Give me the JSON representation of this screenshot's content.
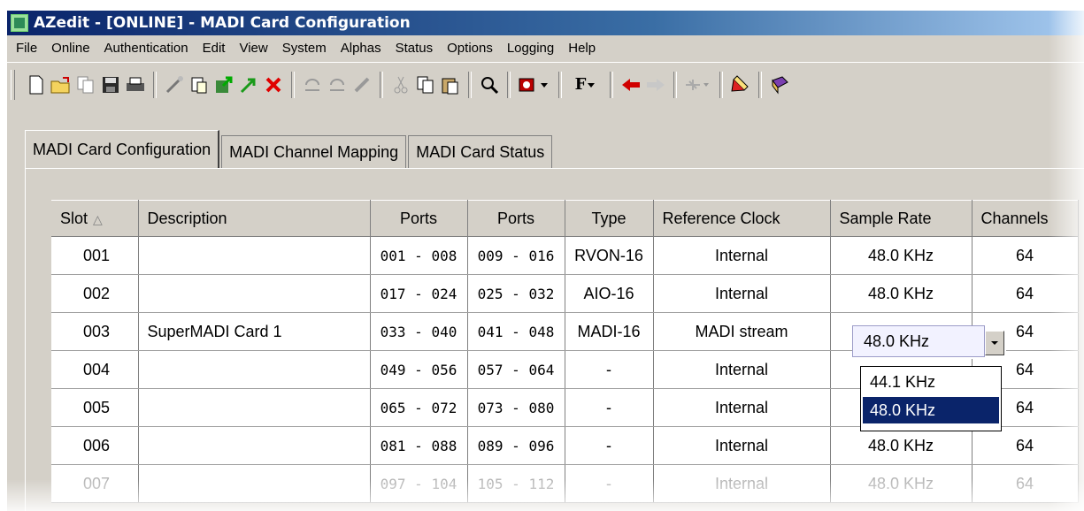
{
  "window": {
    "title": "AZedit - [ONLINE] - MADI Card Configuration"
  },
  "menu": [
    "File",
    "Online",
    "Authentication",
    "Edit",
    "View",
    "System",
    "Alphas",
    "Status",
    "Options",
    "Logging",
    "Help"
  ],
  "toolbar": {
    "icons": [
      "new-icon",
      "open-icon",
      "copy-doc-icon",
      "save-icon",
      "print-icon",
      "wand-icon",
      "paste-doc-icon",
      "upload-icon",
      "arrow-up-green-icon",
      "cancel-icon",
      "undo-icon",
      "redo-icon",
      "pen-icon",
      "cut-icon",
      "copy-icon",
      "paste-icon",
      "search-icon",
      "keypanel-icon",
      "font-icon",
      "back-icon",
      "forward-icon",
      "network-icon",
      "marker-icon",
      "book-icon"
    ],
    "font_label": "F"
  },
  "tabs": [
    "MADI Card Configuration",
    "MADI Channel Mapping",
    "MADI Card Status"
  ],
  "grid": {
    "columns": [
      "Slot",
      "Description",
      "Ports",
      "Ports",
      "Type",
      "Reference Clock",
      "Sample Rate",
      "Channels"
    ],
    "sort_indicator": "△",
    "rows": [
      {
        "slot": "001",
        "desc": "",
        "ports_a": "001 - 008",
        "ports_b": "009 - 016",
        "type": "RVON-16",
        "clock": "Internal",
        "rate": "48.0 KHz",
        "channels": "64"
      },
      {
        "slot": "002",
        "desc": "",
        "ports_a": "017 - 024",
        "ports_b": "025 - 032",
        "type": "AIO-16",
        "clock": "Internal",
        "rate": "48.0 KHz",
        "channels": "64"
      },
      {
        "slot": "003",
        "desc": "SuperMADI Card 1",
        "ports_a": "033 - 040",
        "ports_b": "041 - 048",
        "type": "MADI-16",
        "clock": "MADI stream",
        "rate": "",
        "channels": "64"
      },
      {
        "slot": "004",
        "desc": "",
        "ports_a": "049 - 056",
        "ports_b": "057 - 064",
        "type": "-",
        "clock": "Internal",
        "rate": "",
        "channels": "64"
      },
      {
        "slot": "005",
        "desc": "",
        "ports_a": "065 - 072",
        "ports_b": "073 - 080",
        "type": "-",
        "clock": "Internal",
        "rate": "",
        "channels": "64"
      },
      {
        "slot": "006",
        "desc": "",
        "ports_a": "081 - 088",
        "ports_b": "089 - 096",
        "type": "-",
        "clock": "Internal",
        "rate": "48.0 KHz",
        "channels": "64"
      },
      {
        "slot": "007",
        "desc": "",
        "ports_a": "097 - 104",
        "ports_b": "105 - 112",
        "type": "-",
        "clock": "Internal",
        "rate": "48.0 KHz",
        "channels": "64"
      }
    ]
  },
  "dropdown": {
    "value": "48.0 KHz",
    "options": [
      "44.1 KHz",
      "48.0 KHz"
    ],
    "selected_index": 1
  }
}
